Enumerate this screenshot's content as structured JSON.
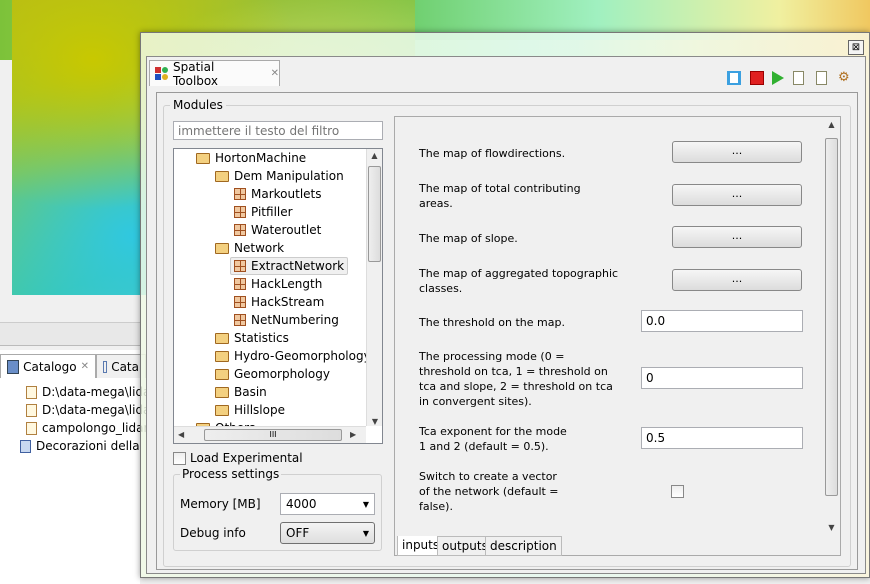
{
  "background": {
    "catalog_tabs": [
      {
        "label": "Catalogo",
        "icon": "catalog-icon"
      },
      {
        "label": "Cata"
      }
    ],
    "catalog_items": [
      "D:\\data-mega\\lida",
      "D:\\data-mega\\lida",
      "campolongo_lidar",
      "Decorazioni della"
    ]
  },
  "dialog": {
    "close_label": "⊠",
    "view_tab": {
      "title": "Spatial Toolbox",
      "close": "✕"
    },
    "toolbar": [
      "layout-toggle-icon",
      "stop-icon",
      "run-icon",
      "generate-script-icon",
      "new-script-icon",
      "settings-icon"
    ],
    "modules": {
      "group_label": "Modules",
      "filter_placeholder": "immettere il testo del filtro",
      "tree": [
        {
          "label": "HortonMachine",
          "type": "folder",
          "level": 0
        },
        {
          "label": "Dem Manipulation",
          "type": "folder",
          "level": 1
        },
        {
          "label": "Markoutlets",
          "type": "module",
          "level": 2
        },
        {
          "label": "Pitfiller",
          "type": "module",
          "level": 2
        },
        {
          "label": "Wateroutlet",
          "type": "module",
          "level": 2
        },
        {
          "label": "Network",
          "type": "folder",
          "level": 1
        },
        {
          "label": "ExtractNetwork",
          "type": "module",
          "level": 2,
          "selected": true
        },
        {
          "label": "HackLength",
          "type": "module",
          "level": 2
        },
        {
          "label": "HackStream",
          "type": "module",
          "level": 2
        },
        {
          "label": "NetNumbering",
          "type": "module",
          "level": 2
        },
        {
          "label": "Statistics",
          "type": "folder",
          "level": 1
        },
        {
          "label": "Hydro-Geomorphology",
          "type": "folder",
          "level": 1
        },
        {
          "label": "Geomorphology",
          "type": "folder",
          "level": 1
        },
        {
          "label": "Basin",
          "type": "folder",
          "level": 1
        },
        {
          "label": "Hillslope",
          "type": "folder",
          "level": 1
        },
        {
          "label": "Others",
          "type": "folder",
          "level": 0
        }
      ],
      "hscroll_grip": "III",
      "load_experimental": {
        "label": "Load Experimental",
        "checked": false
      },
      "process_settings": {
        "label": "Process settings",
        "memory_label": "Memory [MB]",
        "memory_value": "4000",
        "debug_label": "Debug info",
        "debug_value": "OFF"
      }
    },
    "params": [
      {
        "label": "The map of flowdirections.",
        "kind": "button",
        "value": "..."
      },
      {
        "label": "The map of total contributing areas.",
        "kind": "button",
        "value": "..."
      },
      {
        "label": "The map of slope.",
        "kind": "button",
        "value": "..."
      },
      {
        "label": "The map of aggregated topographic classes.",
        "kind": "button",
        "value": "..."
      },
      {
        "label": "The threshold on the map.",
        "kind": "text",
        "value": "0.0"
      },
      {
        "label": "The processing mode (0 = threshold on tca, 1 = threshold on tca and slope, 2 = threshold on tca in convergent sites).",
        "kind": "text",
        "value": "0"
      },
      {
        "label": "Tca exponent for the mode 1 and 2 (default = 0.5).",
        "kind": "text",
        "value": "0.5"
      },
      {
        "label": "Switch to create a vector of the network (default = false).",
        "kind": "checkbox",
        "checked": false
      }
    ],
    "bottom_tabs": [
      "inputs",
      "outputs",
      "description"
    ],
    "active_tab": "inputs"
  }
}
